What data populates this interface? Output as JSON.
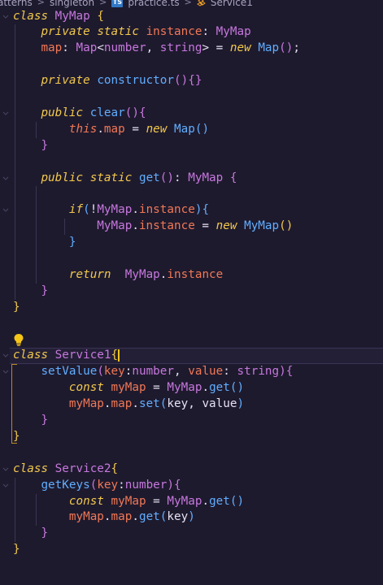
{
  "breadcrumb": {
    "segments": [
      "atterns",
      "singleton",
      "practice.ts",
      "Service1"
    ],
    "separator": ">",
    "file_icon": "ts-file-icon",
    "symbol_icon": "class-symbol-icon"
  },
  "editor": {
    "lines": [
      {
        "tokens": [
          [
            "kw",
            "class"
          ],
          [
            "plain",
            " "
          ],
          [
            "cls",
            "MyMap"
          ],
          [
            "plain",
            " "
          ],
          [
            "brace1",
            "{"
          ]
        ]
      },
      {
        "tokens": [
          [
            "plain",
            "    "
          ],
          [
            "kw",
            "private"
          ],
          [
            "plain",
            " "
          ],
          [
            "kw",
            "static"
          ],
          [
            "plain",
            " "
          ],
          [
            "prop",
            "instance"
          ],
          [
            "plain",
            ": "
          ],
          [
            "type",
            "MyMap"
          ]
        ]
      },
      {
        "tokens": [
          [
            "plain",
            "    "
          ],
          [
            "prop",
            "map"
          ],
          [
            "plain",
            ": "
          ],
          [
            "type",
            "Map"
          ],
          [
            "plain",
            "<"
          ],
          [
            "type",
            "number"
          ],
          [
            "plain",
            ", "
          ],
          [
            "type",
            "string"
          ],
          [
            "plain",
            "> = "
          ],
          [
            "kw",
            "new"
          ],
          [
            "plain",
            " "
          ],
          [
            "fn",
            "Map"
          ],
          [
            "brace2",
            "()"
          ],
          [
            "plain",
            ";"
          ]
        ]
      },
      {
        "tokens": []
      },
      {
        "tokens": [
          [
            "plain",
            "    "
          ],
          [
            "kw",
            "private"
          ],
          [
            "plain",
            " "
          ],
          [
            "fn",
            "constructor"
          ],
          [
            "brace2",
            "()"
          ],
          [
            "brace2",
            "{}"
          ]
        ]
      },
      {
        "tokens": []
      },
      {
        "tokens": [
          [
            "plain",
            "    "
          ],
          [
            "kw",
            "public"
          ],
          [
            "plain",
            " "
          ],
          [
            "fn",
            "clear"
          ],
          [
            "brace2",
            "()"
          ],
          [
            "brace2",
            "{"
          ]
        ]
      },
      {
        "tokens": [
          [
            "plain",
            "        "
          ],
          [
            "this",
            "this"
          ],
          [
            "plain",
            "."
          ],
          [
            "prop",
            "map"
          ],
          [
            "plain",
            " = "
          ],
          [
            "kw",
            "new"
          ],
          [
            "plain",
            " "
          ],
          [
            "fn",
            "Map"
          ],
          [
            "brace3",
            "()"
          ]
        ]
      },
      {
        "tokens": [
          [
            "plain",
            "    "
          ],
          [
            "brace2",
            "}"
          ]
        ]
      },
      {
        "tokens": []
      },
      {
        "tokens": [
          [
            "plain",
            "    "
          ],
          [
            "kw",
            "public"
          ],
          [
            "plain",
            " "
          ],
          [
            "kw",
            "static"
          ],
          [
            "plain",
            " "
          ],
          [
            "fn",
            "get"
          ],
          [
            "brace2",
            "()"
          ],
          [
            "plain",
            ": "
          ],
          [
            "type",
            "MyMap"
          ],
          [
            "plain",
            " "
          ],
          [
            "brace2",
            "{"
          ]
        ]
      },
      {
        "tokens": []
      },
      {
        "tokens": [
          [
            "plain",
            "        "
          ],
          [
            "kw",
            "if"
          ],
          [
            "brace3",
            "("
          ],
          [
            "plain",
            "!"
          ],
          [
            "cls",
            "MyMap"
          ],
          [
            "plain",
            "."
          ],
          [
            "prop",
            "instance"
          ],
          [
            "brace3",
            ")"
          ],
          [
            "brace3",
            "{"
          ]
        ]
      },
      {
        "tokens": [
          [
            "plain",
            "            "
          ],
          [
            "cls",
            "MyMap"
          ],
          [
            "plain",
            "."
          ],
          [
            "prop",
            "instance"
          ],
          [
            "plain",
            " = "
          ],
          [
            "kw",
            "new"
          ],
          [
            "plain",
            " "
          ],
          [
            "fn",
            "MyMap"
          ],
          [
            "brace1",
            "()"
          ]
        ]
      },
      {
        "tokens": [
          [
            "plain",
            "        "
          ],
          [
            "brace3",
            "}"
          ]
        ]
      },
      {
        "tokens": []
      },
      {
        "tokens": [
          [
            "plain",
            "        "
          ],
          [
            "kw",
            "return"
          ],
          [
            "plain",
            "  "
          ],
          [
            "cls",
            "MyMap"
          ],
          [
            "plain",
            "."
          ],
          [
            "prop",
            "instance"
          ]
        ]
      },
      {
        "tokens": [
          [
            "plain",
            "    "
          ],
          [
            "brace2",
            "}"
          ]
        ]
      },
      {
        "tokens": [
          [
            "brace1",
            "}"
          ]
        ]
      },
      {
        "tokens": []
      },
      {
        "tokens": []
      },
      {
        "tokens": [
          [
            "kw",
            "class"
          ],
          [
            "plain",
            " "
          ],
          [
            "cls",
            "Service1"
          ],
          [
            "brace1",
            "{"
          ]
        ],
        "cursor": true,
        "current": true
      },
      {
        "tokens": [
          [
            "plain",
            "    "
          ],
          [
            "fn",
            "setValue"
          ],
          [
            "brace2",
            "("
          ],
          [
            "param",
            "key"
          ],
          [
            "plain",
            ":"
          ],
          [
            "type",
            "number"
          ],
          [
            "plain",
            ", "
          ],
          [
            "param",
            "value"
          ],
          [
            "plain",
            ": "
          ],
          [
            "type",
            "string"
          ],
          [
            "brace2",
            ")"
          ],
          [
            "brace2",
            "{"
          ]
        ]
      },
      {
        "tokens": [
          [
            "plain",
            "        "
          ],
          [
            "kw",
            "const"
          ],
          [
            "plain",
            " "
          ],
          [
            "prop",
            "myMap"
          ],
          [
            "plain",
            " = "
          ],
          [
            "cls",
            "MyMap"
          ],
          [
            "plain",
            "."
          ],
          [
            "fn",
            "get"
          ],
          [
            "brace3",
            "()"
          ]
        ]
      },
      {
        "tokens": [
          [
            "plain",
            "        "
          ],
          [
            "prop",
            "myMap"
          ],
          [
            "plain",
            "."
          ],
          [
            "prop",
            "map"
          ],
          [
            "plain",
            "."
          ],
          [
            "fn",
            "set"
          ],
          [
            "brace3",
            "("
          ],
          [
            "plain",
            "key, value"
          ],
          [
            "brace3",
            ")"
          ]
        ]
      },
      {
        "tokens": [
          [
            "plain",
            "    "
          ],
          [
            "brace2",
            "}"
          ]
        ]
      },
      {
        "tokens": [
          [
            "brace1",
            "}"
          ]
        ]
      },
      {
        "tokens": []
      },
      {
        "tokens": [
          [
            "kw",
            "class"
          ],
          [
            "plain",
            " "
          ],
          [
            "cls",
            "Service2"
          ],
          [
            "brace1",
            "{"
          ]
        ]
      },
      {
        "tokens": [
          [
            "plain",
            "    "
          ],
          [
            "fn",
            "getKeys"
          ],
          [
            "brace2",
            "("
          ],
          [
            "param",
            "key"
          ],
          [
            "plain",
            ":"
          ],
          [
            "type",
            "number"
          ],
          [
            "brace2",
            ")"
          ],
          [
            "brace2",
            "{"
          ]
        ]
      },
      {
        "tokens": [
          [
            "plain",
            "        "
          ],
          [
            "kw",
            "const"
          ],
          [
            "plain",
            " "
          ],
          [
            "prop",
            "myMap"
          ],
          [
            "plain",
            " = "
          ],
          [
            "cls",
            "MyMap"
          ],
          [
            "plain",
            "."
          ],
          [
            "fn",
            "get"
          ],
          [
            "brace3",
            "()"
          ]
        ]
      },
      {
        "tokens": [
          [
            "plain",
            "        "
          ],
          [
            "prop",
            "myMap"
          ],
          [
            "plain",
            "."
          ],
          [
            "prop",
            "map"
          ],
          [
            "plain",
            "."
          ],
          [
            "fn",
            "get"
          ],
          [
            "brace3",
            "("
          ],
          [
            "plain",
            "key"
          ],
          [
            "brace3",
            ")"
          ]
        ]
      },
      {
        "tokens": [
          [
            "plain",
            "    "
          ],
          [
            "brace2",
            "}"
          ]
        ]
      },
      {
        "tokens": [
          [
            "brace1",
            "}"
          ]
        ]
      }
    ],
    "lightbulb_icon": "lightbulb-icon"
  }
}
